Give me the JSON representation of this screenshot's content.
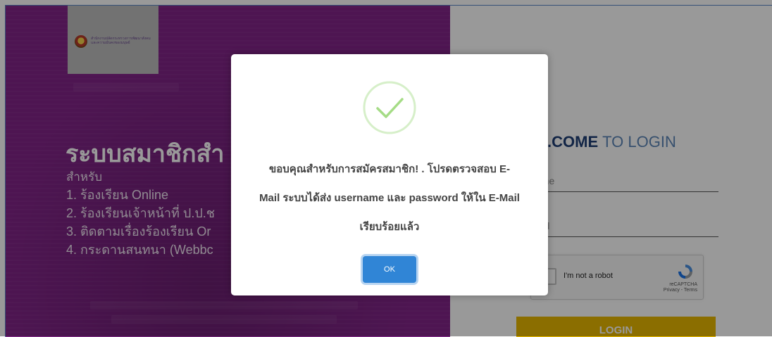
{
  "left": {
    "logo": {
      "line1": "สำนักงานปลัดกระทรวงการพัฒนาสังคม",
      "line2": "และความมั่นคงของมนุษย์"
    },
    "title": "ระบบสมาชิกสำ",
    "subtitle": "สำหรับ",
    "items": [
      "1. ร้องเรียน Online",
      "2. ร้องเรียนเจ้าหน้าที่ ป.ป.ช",
      "3. ติดตามเรื่องร้องเรียน Or",
      "4. กระดานสนทนา (Webbc"
    ]
  },
  "login": {
    "welcome_strong": ".COME",
    "welcome_rest": "TO LOGIN",
    "username_placeholder": "ame",
    "password_placeholder": "ord",
    "recaptcha_label": "I'm not a robot",
    "recaptcha_brand": "reCAPTCHA",
    "recaptcha_links": "Privacy - Terms",
    "login_label": "LOGIN"
  },
  "modal": {
    "icon": "success-check-icon",
    "message_lines": [
      "ขอบคุณสำหรับการสมัครสมาชิก! . โปรดตรวจสอบ E-",
      "Mail ระบบได้ส่ง username และ password ให้ใน E-Mail",
      "เรียบร้อยแล้ว"
    ],
    "ok_label": "OK"
  },
  "colors": {
    "purple_panel": "#822489",
    "login_button": "#e8b800",
    "ok_button": "#3085d6",
    "success_green": "#a5dc86"
  }
}
